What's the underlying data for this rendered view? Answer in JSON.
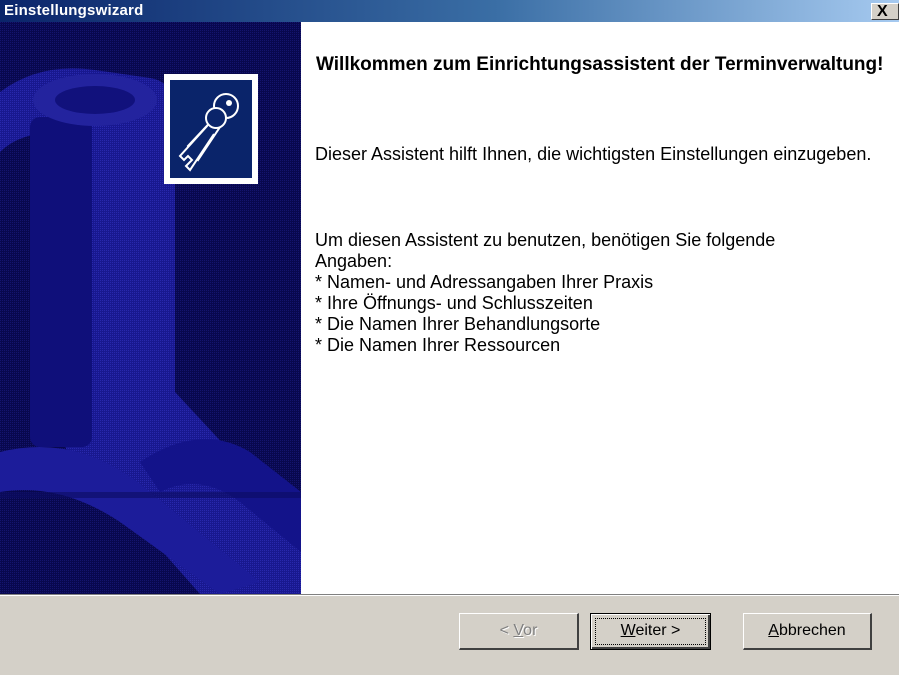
{
  "window": {
    "title": "Einstellungswizard",
    "close_glyph": "X"
  },
  "banner": {
    "icon": "keys-icon",
    "colors": {
      "background": "#0a0a5a",
      "shape": "#1a1aa0",
      "icon_frame": "#0a246a"
    }
  },
  "content": {
    "heading": "Willkommen zum Einrichtungsassistent der Terminverwaltung!",
    "intro": "Dieser Assistent hilft Ihnen, die wichtigsten Einstellungen einzugeben.",
    "requirements_intro": "Um diesen Assistent zu benutzen, benötigen Sie folgende Angaben:",
    "requirements": [
      "* Namen- und Adressangaben Ihrer Praxis",
      "* Ihre Öffnungs- und Schlusszeiten",
      "* Die Namen Ihrer Behandlungsorte",
      "* Die Namen Ihrer Ressourcen"
    ]
  },
  "buttons": {
    "back": {
      "prefix": "< ",
      "mnemonic": "V",
      "rest": "or",
      "enabled": false
    },
    "next": {
      "mnemonic": "W",
      "rest": "eiter >",
      "default": true
    },
    "cancel": {
      "mnemonic": "A",
      "rest": "bbrechen"
    }
  }
}
